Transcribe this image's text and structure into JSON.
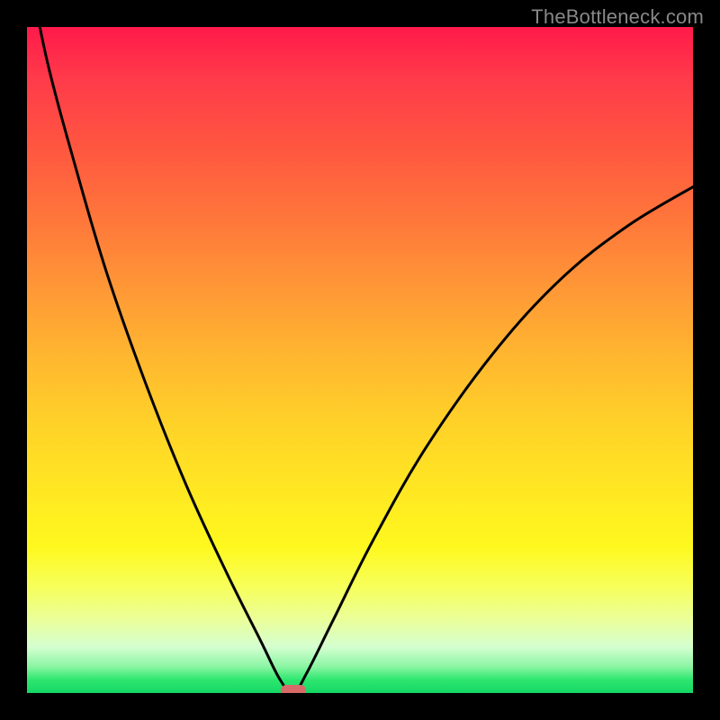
{
  "watermark": "TheBottleneck.com",
  "chart_data": {
    "type": "line",
    "title": "",
    "xlabel": "",
    "ylabel": "",
    "xlim": [
      0,
      100
    ],
    "ylim": [
      0,
      100
    ],
    "grid": false,
    "legend": false,
    "annotations": [],
    "colors": {
      "top": "#ff1a4a",
      "upper_mid": "#ff9a36",
      "mid": "#ffe822",
      "lower": "#d6ffd0",
      "bottom": "#14d864",
      "curve_stroke": "#000000",
      "minimum_marker": "#d96a6a",
      "frame": "#000000"
    },
    "minimum": {
      "x": 40,
      "y": 0
    },
    "series": [
      {
        "name": "left-branch",
        "x": [
          0,
          3,
          7,
          12,
          18,
          24,
          30,
          35,
          38,
          40
        ],
        "y": [
          110,
          95,
          80,
          63,
          46,
          31,
          18,
          8,
          2,
          0
        ]
      },
      {
        "name": "right-branch",
        "x": [
          40,
          42,
          46,
          52,
          60,
          70,
          80,
          90,
          100
        ],
        "y": [
          0,
          3,
          11,
          23,
          37,
          51,
          62,
          70,
          76
        ]
      }
    ]
  }
}
